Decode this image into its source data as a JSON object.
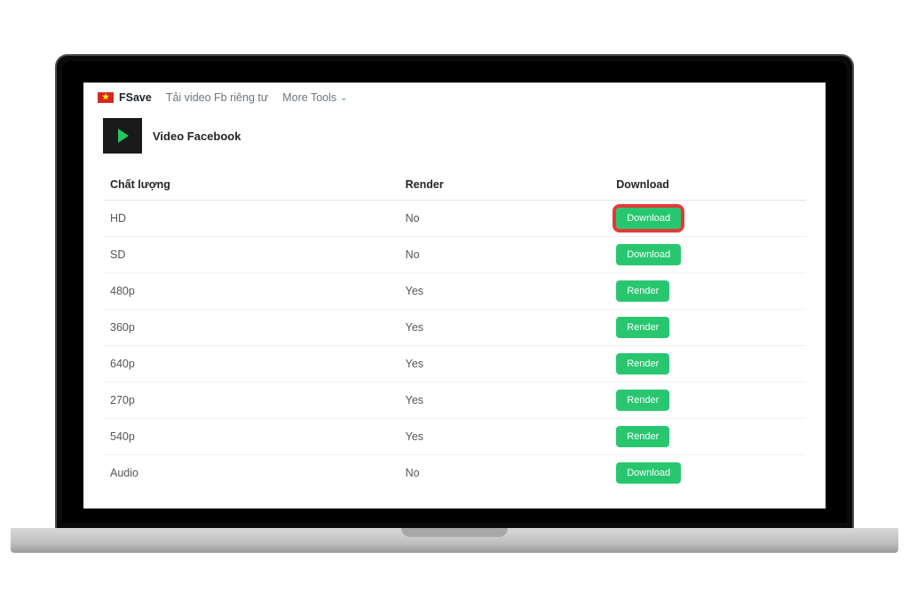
{
  "nav": {
    "brand": "FSave",
    "link_private": "Tải video Fb riêng tư",
    "link_more": "More Tools"
  },
  "video": {
    "title": "Video Facebook"
  },
  "table": {
    "headers": {
      "quality": "Chất lượng",
      "render": "Render",
      "download": "Download"
    },
    "rows": [
      {
        "quality": "HD",
        "render": "No",
        "action": "Download",
        "highlighted": true
      },
      {
        "quality": "SD",
        "render": "No",
        "action": "Download",
        "highlighted": false
      },
      {
        "quality": "480p",
        "render": "Yes",
        "action": "Render",
        "highlighted": false
      },
      {
        "quality": "360p",
        "render": "Yes",
        "action": "Render",
        "highlighted": false
      },
      {
        "quality": "640p",
        "render": "Yes",
        "action": "Render",
        "highlighted": false
      },
      {
        "quality": "270p",
        "render": "Yes",
        "action": "Render",
        "highlighted": false
      },
      {
        "quality": "540p",
        "render": "Yes",
        "action": "Render",
        "highlighted": false
      },
      {
        "quality": "Audio",
        "render": "No",
        "action": "Download",
        "highlighted": false
      }
    ]
  }
}
